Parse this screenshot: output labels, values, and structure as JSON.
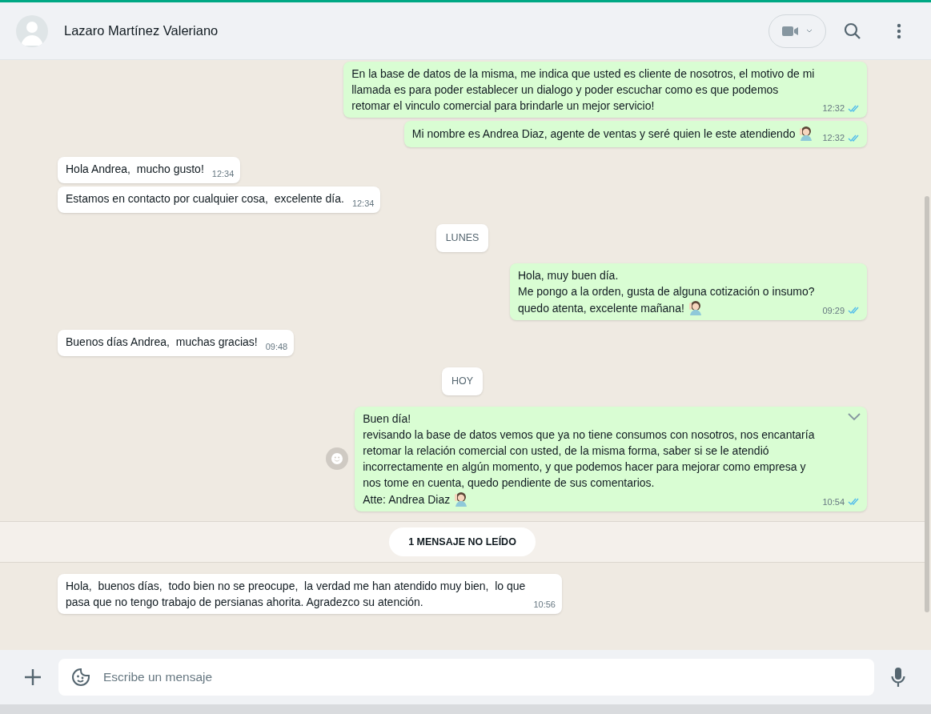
{
  "header": {
    "contact_name": "Lazaro Martínez Valeriano"
  },
  "messages": [
    {
      "kind": "out",
      "lines": [
        "En la base de datos de la misma, me indica que usted es cliente de nosotros, el motivo de mi",
        "llamada es para poder establecer un dialogo y poder escuchar como es que podemos",
        "retomar el vinculo comercial para brindarle un mejor servicio!"
      ],
      "time": "12:32",
      "read": true
    },
    {
      "kind": "out",
      "lines": [
        "Mi nombre es Andrea Diaz, agente de ventas y seré quien le este atendiendo"
      ],
      "time": "12:32",
      "read": true,
      "emoji": true
    },
    {
      "kind": "in",
      "lines": [
        "Hola Andrea,  mucho gusto!"
      ],
      "time": "12:34"
    },
    {
      "kind": "in",
      "lines": [
        "Estamos en contacto por cualquier cosa,  excelente día."
      ],
      "time": "12:34"
    },
    {
      "kind": "date",
      "label": "LUNES"
    },
    {
      "kind": "out",
      "lines": [
        "Hola, muy buen día.",
        "Me pongo a la orden, gusta de alguna cotización o insumo?",
        "quedo atenta, excelente mañana!"
      ],
      "time": "09:29",
      "read": true,
      "emoji": true
    },
    {
      "kind": "in",
      "lines": [
        "Buenos días Andrea,  muchas gracias!"
      ],
      "time": "09:48"
    },
    {
      "kind": "date",
      "label": "HOY"
    },
    {
      "kind": "out",
      "lines": [
        "Buen día!",
        "revisando la base de datos vemos que ya no tiene consumos con nosotros, nos encantaría",
        "retomar la relación comercial con usted, de la misma forma, saber si se le atendió",
        "incorrectamente en algún momento, y que podemos hacer para mejorar como empresa y",
        "nos tome en cuenta, quedo pendiente de sus comentarios.",
        "Atte: Andrea Diaz"
      ],
      "time": "10:54",
      "read": true,
      "emoji": true,
      "hovered": true
    },
    {
      "kind": "unread",
      "label": "1 MENSAJE NO LEÍDO"
    },
    {
      "kind": "in",
      "lines": [
        "Hola,  buenos días,  todo bien no se preocupe,  la verdad me han atendido muy bien,  lo que",
        "pasa que no tengo trabajo de persianas ahorita. Agradezco su atención."
      ],
      "time": "10:56"
    }
  ],
  "composer": {
    "placeholder": "Escribe un mensaje"
  }
}
